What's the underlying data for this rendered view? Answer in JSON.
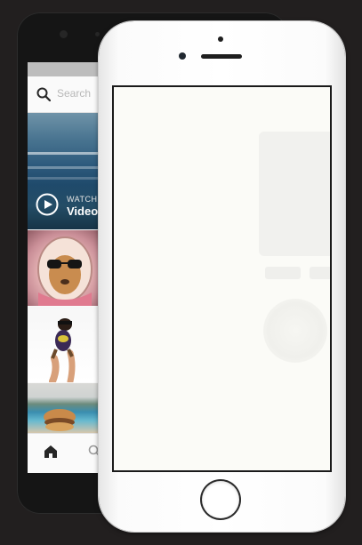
{
  "search": {
    "placeholder": "Search"
  },
  "feed": {
    "video_tile": {
      "watch_label": "WATCH",
      "video_label": "Video"
    }
  },
  "bottom_nav": {
    "items": [
      "home-icon",
      "search-icon"
    ]
  },
  "icons": [
    "search-icon",
    "play-icon",
    "home-icon",
    "search-icon"
  ]
}
